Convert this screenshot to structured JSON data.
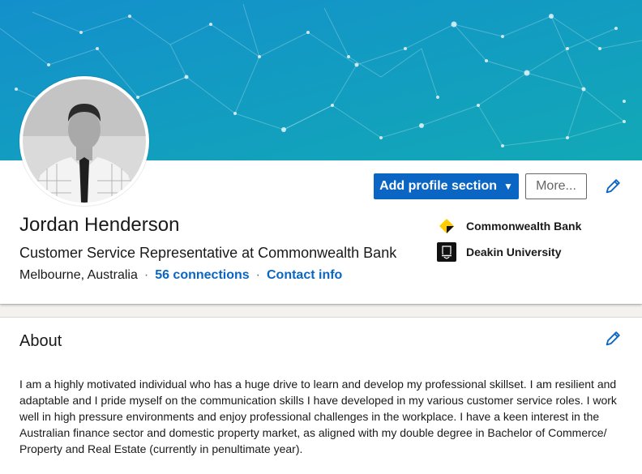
{
  "profile": {
    "name": "Jordan Henderson",
    "headline": "Customer Service Representative at Commonwealth Bank",
    "location": "Melbourne, Australia",
    "separator": "·",
    "connections_label": "56 connections",
    "contact_info_label": "Contact info"
  },
  "actions": {
    "add_profile_section_label": "Add profile section",
    "more_label": "More..."
  },
  "experience_highlights": [
    {
      "name": "Commonwealth Bank",
      "logo_icon": "commonwealth-bank-logo-icon"
    },
    {
      "name": "Deakin University",
      "logo_icon": "deakin-university-logo-icon"
    }
  ],
  "about": {
    "title": "About",
    "text": "I am a highly motivated individual who has a huge drive to learn and develop my professional skillset. I am resilient and adaptable and I pride myself on the communication skills I have developed in my various customer service roles. I work well in high pressure environments and enjoy professional challenges in the workplace. I have a keen interest in the Australian finance sector and domestic property market, as aligned with my double degree in Bachelor of Commerce/ Property and Real Estate (currently in penultimate year)."
  },
  "colors": {
    "primary": "#0a66c2",
    "banner_start": "#1289c9",
    "banner_end": "#14aab7",
    "page_bg": "#f3f2ef"
  }
}
